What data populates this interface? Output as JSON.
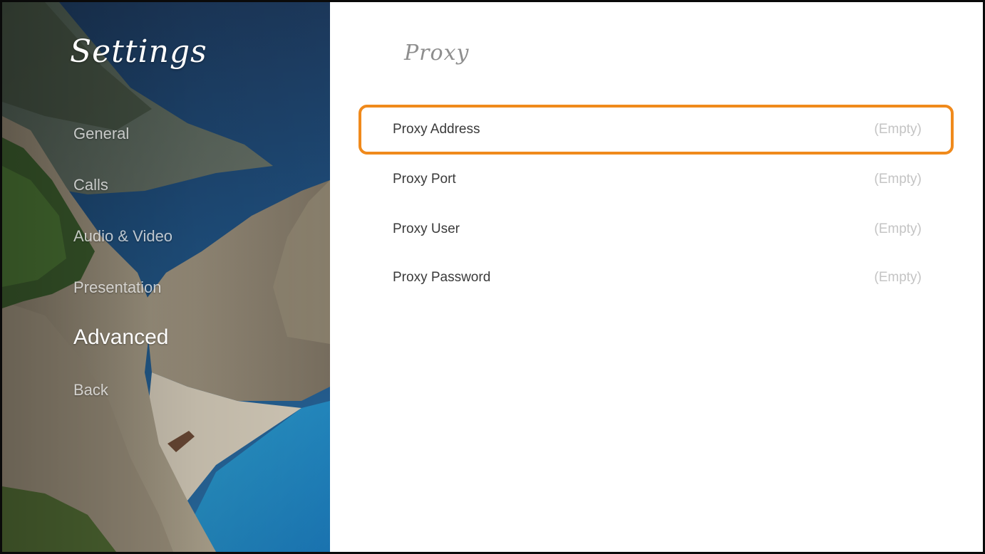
{
  "sidebar": {
    "title": "Settings",
    "items": [
      {
        "label": "General",
        "active": false
      },
      {
        "label": "Calls",
        "active": false
      },
      {
        "label": "Audio & Video",
        "active": false
      },
      {
        "label": "Presentation",
        "active": false
      },
      {
        "label": "Advanced",
        "active": true
      },
      {
        "label": "Back",
        "active": false
      }
    ]
  },
  "main": {
    "section_title": "Proxy",
    "rows": [
      {
        "label": "Proxy Address",
        "value": "(Empty)",
        "focused": true
      },
      {
        "label": "Proxy Port",
        "value": "(Empty)",
        "focused": false
      },
      {
        "label": "Proxy User",
        "value": "(Empty)",
        "focused": false
      },
      {
        "label": "Proxy Password",
        "value": "(Empty)",
        "focused": false
      }
    ]
  },
  "colors": {
    "focus_accent": "#f08a1c",
    "label_text": "#3a3a3a",
    "value_text": "#c4c4c4",
    "title_text": "#8e8e8e"
  }
}
